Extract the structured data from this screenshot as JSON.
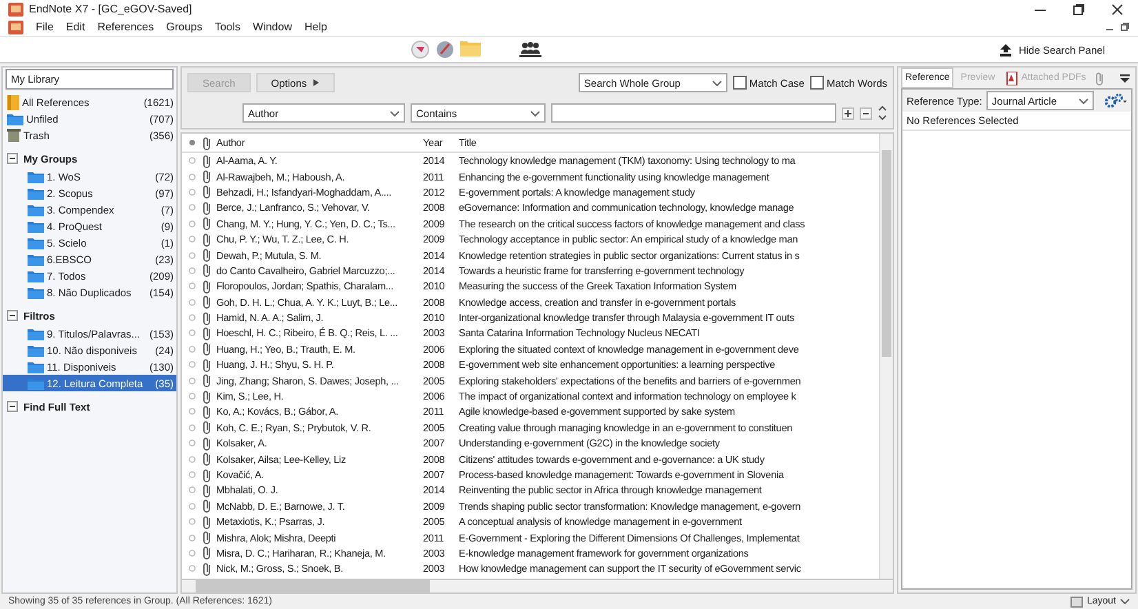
{
  "window": {
    "title": "EndNote X7 - [GC_eGOV-Saved]"
  },
  "menu": [
    {
      "label": "File"
    },
    {
      "label": "Edit"
    },
    {
      "label": "References"
    },
    {
      "label": "Groups"
    },
    {
      "label": "Tools"
    },
    {
      "label": "Window"
    },
    {
      "label": "Help"
    }
  ],
  "toolbar": {
    "hide_search_panel": "Hide Search Panel"
  },
  "sidebar": {
    "header": "My Library",
    "items": [
      {
        "kind": "all",
        "label": "All References",
        "count": "(1621)",
        "selected": false
      },
      {
        "kind": "unfiled",
        "label": "Unfiled",
        "count": "(707)",
        "selected": false
      },
      {
        "kind": "trash",
        "label": "Trash",
        "count": "(356)",
        "selected": false
      }
    ],
    "groups": [
      {
        "label": "My Groups",
        "expanded": true,
        "children": [
          {
            "label": "1. WoS",
            "count": "(72)",
            "selected": false
          },
          {
            "label": "2. Scopus",
            "count": "(97)",
            "selected": false
          },
          {
            "label": "3. Compendex",
            "count": "(7)",
            "selected": false
          },
          {
            "label": "4. ProQuest",
            "count": "(9)",
            "selected": false
          },
          {
            "label": "5. Scielo",
            "count": "(1)",
            "selected": false
          },
          {
            "label": "6.EBSCO",
            "count": "(23)",
            "selected": false
          },
          {
            "label": "7. Todos",
            "count": "(209)",
            "selected": false
          },
          {
            "label": "8. Não Duplicados",
            "count": "(154)",
            "selected": false
          }
        ]
      },
      {
        "label": "Filtros",
        "expanded": true,
        "children": [
          {
            "label": "9. Titulos/Palavras...",
            "count": "(153)",
            "selected": false
          },
          {
            "label": "10. Não disponiveis",
            "count": "(24)",
            "selected": false
          },
          {
            "label": "11. Disponiveis",
            "count": "(130)",
            "selected": false
          },
          {
            "label": "12. Leitura Completa",
            "count": "(35)",
            "selected": true
          }
        ]
      },
      {
        "label": "Find Full Text",
        "expanded": true
      }
    ]
  },
  "search": {
    "search_button": {
      "label": "Search",
      "disabled": true
    },
    "options_button": "Options",
    "scope": "Search Whole Group",
    "match_case": {
      "label": "Match Case",
      "checked": false
    },
    "match_words": {
      "label": "Match Words",
      "checked": false
    },
    "field": "Author",
    "operator": "Contains"
  },
  "table": {
    "columns": [
      "Author",
      "Year",
      "Title"
    ],
    "rows": [
      {
        "read": false,
        "attachment": true,
        "author": "Al-Aama, A. Y.",
        "year": "2014",
        "title": "Technology knowledge management (TKM) taxonomy: Using technology to ma"
      },
      {
        "read": false,
        "attachment": true,
        "author": "Al-Rawajbeh, M.; Haboush, A.",
        "year": "2011",
        "title": "Enhancing the e-government functionality using knowledge management"
      },
      {
        "read": false,
        "attachment": true,
        "author": "Behzadi, H.; Isfandyari-Moghaddam, A....",
        "year": "2012",
        "title": "E-government portals: A knowledge management study"
      },
      {
        "read": false,
        "attachment": true,
        "author": "Berce, J.; Lanfranco, S.; Vehovar, V.",
        "year": "2008",
        "title": "eGovernance: Information and communication technology, knowledge manage"
      },
      {
        "read": false,
        "attachment": true,
        "author": "Chang, M. Y.; Hung, Y. C.; Yen, D. C.; Ts...",
        "year": "2009",
        "title": "The research on the critical success factors of knowledge management and class"
      },
      {
        "read": false,
        "attachment": true,
        "author": "Chu, P. Y.; Wu, T. Z.; Lee, C. H.",
        "year": "2009",
        "title": "Technology acceptance in public sector: An empirical study of a knowledge man"
      },
      {
        "read": false,
        "attachment": true,
        "author": "Dewah, P.; Mutula, S. M.",
        "year": "2014",
        "title": "Knowledge retention strategies in public sector organizations: Current status in s"
      },
      {
        "read": false,
        "attachment": true,
        "author": "do Canto Cavalheiro, Gabriel Marcuzzo;...",
        "year": "2014",
        "title": "Towards a heuristic frame for transferring e-government technology"
      },
      {
        "read": false,
        "attachment": true,
        "author": "Floropoulos, Jordan; Spathis, Charalam...",
        "year": "2010",
        "title": "Measuring the success of the Greek Taxation Information System"
      },
      {
        "read": false,
        "attachment": true,
        "author": "Goh, D. H. L.; Chua, A. Y. K.; Luyt, B.; Le...",
        "year": "2008",
        "title": "Knowledge access, creation and transfer in e-government portals"
      },
      {
        "read": false,
        "attachment": true,
        "author": "Hamid, N. A. A.; Salim, J.",
        "year": "2010",
        "title": "Inter-organizational knowledge transfer through Malaysia e-government IT outs"
      },
      {
        "read": false,
        "attachment": true,
        "author": "Hoeschl, H. C.; Ribeiro, É B. Q.; Reis, L. ...",
        "year": "2003",
        "title": "Santa Catarina Information Technology Nucleus NECATI"
      },
      {
        "read": false,
        "attachment": true,
        "author": "Huang, H.; Yeo, B.; Trauth, E. M.",
        "year": "2006",
        "title": "Exploring the situated context of knowledge management in e-government deve"
      },
      {
        "read": false,
        "attachment": true,
        "author": "Huang, J. H.; Shyu, S. H. P.",
        "year": "2008",
        "title": "E-government web site enhancement opportunities: a learning perspective"
      },
      {
        "read": false,
        "attachment": true,
        "author": "Jing, Zhang; Sharon, S. Dawes; Joseph, ...",
        "year": "2005",
        "title": "Exploring stakeholders' expectations of the benefits and barriers of e-governmen"
      },
      {
        "read": false,
        "attachment": true,
        "author": "Kim, S.; Lee, H.",
        "year": "2006",
        "title": "The impact of organizational context and information technology on employee k"
      },
      {
        "read": false,
        "attachment": true,
        "author": "Ko, A.; Kovács, B.; Gábor, A.",
        "year": "2011",
        "title": "Agile knowledge-based e-government supported by sake system"
      },
      {
        "read": false,
        "attachment": true,
        "author": "Koh, C. E.; Ryan, S.; Prybutok, V. R.",
        "year": "2005",
        "title": "Creating value through managing knowledge in an e-government to constituen"
      },
      {
        "read": false,
        "attachment": true,
        "author": "Kolsaker, A.",
        "year": "2007",
        "title": "Understanding e-government (G2C) in the knowledge society"
      },
      {
        "read": false,
        "attachment": true,
        "author": "Kolsaker, Ailsa; Lee-Kelley, Liz",
        "year": "2008",
        "title": "Citizens' attitudes towards e-government and e-governance: a UK study"
      },
      {
        "read": false,
        "attachment": true,
        "author": "Kovačić, A.",
        "year": "2007",
        "title": "Process-based knowledge management: Towards e-government in Slovenia"
      },
      {
        "read": false,
        "attachment": true,
        "author": "Mbhalati, O. J.",
        "year": "2014",
        "title": "Reinventing the public sector in Africa through knowledge management"
      },
      {
        "read": false,
        "attachment": true,
        "author": "McNabb, D. E.; Barnowe, J. T.",
        "year": "2009",
        "title": "Trends shaping public sector transformation: Knowledge management, e-govern"
      },
      {
        "read": false,
        "attachment": true,
        "author": "Metaxiotis, K.; Psarras, J.",
        "year": "2005",
        "title": "A conceptual analysis of knowledge management in e-government"
      },
      {
        "read": false,
        "attachment": true,
        "author": "Mishra, Alok; Mishra, Deepti",
        "year": "2011",
        "title": "E-Government - Exploring the Different Dimensions Of Challenges, Implementat"
      },
      {
        "read": false,
        "attachment": true,
        "author": "Misra, D. C.; Hariharan, R.; Khaneja, M.",
        "year": "2003",
        "title": "E-knowledge management framework for government organizations"
      },
      {
        "read": false,
        "attachment": true,
        "author": "Nick, M.; Gross, S.; Snoek, B.",
        "year": "2003",
        "title": "How knowledge management can support the IT security of eGovernment servic"
      }
    ]
  },
  "reference_panel": {
    "tabs": [
      {
        "label": "Reference",
        "selected": true,
        "disabled": false
      },
      {
        "label": "Preview",
        "selected": false,
        "disabled": true
      },
      {
        "label": "Attached PDFs",
        "selected": false,
        "disabled": true
      }
    ],
    "reference_type_label": "Reference Type:",
    "reference_type": "Journal Article",
    "message": "No References Selected"
  },
  "status_bar": {
    "text": "Showing 35 of 35 references in Group. (All References: 1621)",
    "layout": "Layout"
  }
}
